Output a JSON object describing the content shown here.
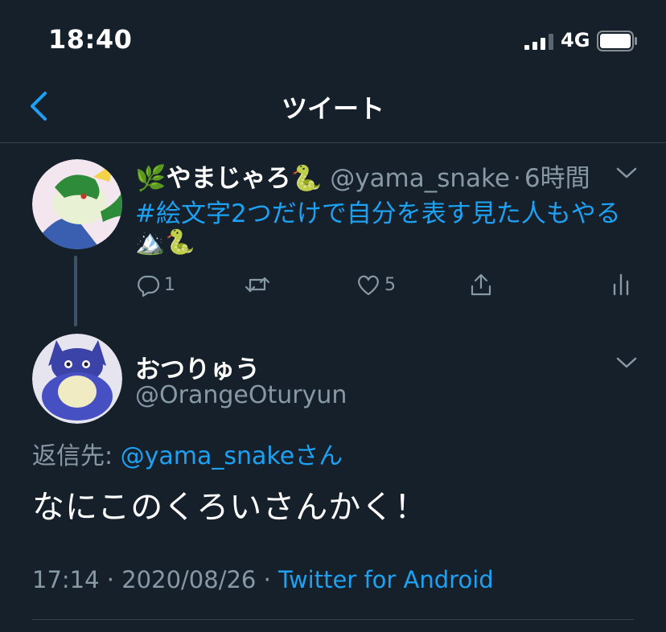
{
  "status_bar": {
    "time": "18:40",
    "network": "4G"
  },
  "nav": {
    "title": "ツイート"
  },
  "tweet_parent": {
    "name_prefix_emoji": "🌿",
    "name": "やまじゃろ",
    "name_suffix_emoji": "🐍",
    "handle": "@yama_snake",
    "separator": "·",
    "time": "6時間",
    "hashtag": "#絵文字2つだけで自分を表す見た人もやる",
    "emojis": "🏔️🐍",
    "actions": {
      "reply_count": "1",
      "retweet_count": "",
      "like_count": "5"
    }
  },
  "tweet_reply": {
    "name": "おつりゅう",
    "handle": "@OrangeOturyun",
    "reply_to_label": "返信先: ",
    "reply_to_handle": "@yama_snake",
    "reply_to_suffix": "さん",
    "text": "なにこのくろいさんかく！",
    "timestamp": "17:14 · 2020/08/26 · ",
    "client": "Twitter for Android"
  },
  "colors": {
    "background": "#15202b",
    "accent": "#1da1f2",
    "muted": "#8899a6",
    "divider": "#38444d"
  },
  "icons": [
    "signal-bars-icon",
    "battery-icon",
    "back-chevron-icon",
    "chevron-down-icon",
    "reply-icon",
    "retweet-icon",
    "like-icon",
    "share-icon",
    "analytics-icon"
  ]
}
